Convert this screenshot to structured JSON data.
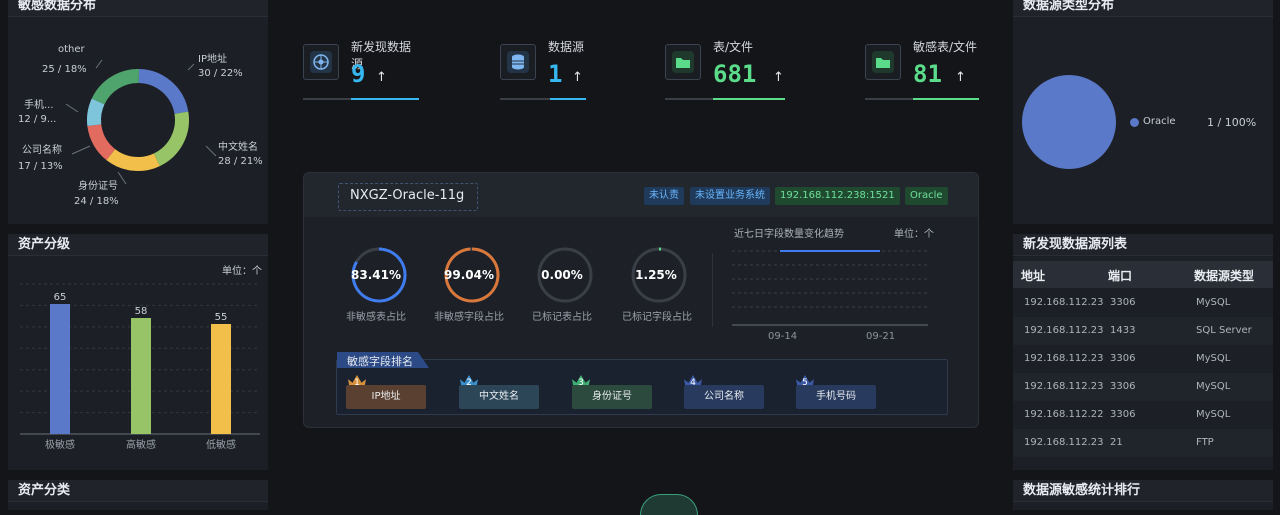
{
  "left_top": {
    "title": "敏感数据分布",
    "labels": [
      {
        "name": "other",
        "value": "25 / 18%"
      },
      {
        "name": "IP地址",
        "value": "30 / 22%"
      },
      {
        "name": "手机...",
        "value": "12 / 9..."
      },
      {
        "name": "中文姓名",
        "value": "28 / 21%"
      },
      {
        "name": "公司名称",
        "value": "17 / 13%"
      },
      {
        "name": "身份证号",
        "value": "24 / 18%"
      }
    ]
  },
  "asset_grade": {
    "title": "资产分级",
    "unit": "单位：个",
    "bar_labels": [
      "65",
      "58",
      "55"
    ],
    "categories": [
      "极敏感",
      "高敏感",
      "低敏感"
    ]
  },
  "asset_class": {
    "title": "资产分类"
  },
  "kpis": [
    {
      "label": "新发现数据源",
      "value": "9",
      "arrow": "↑",
      "color": "#36b7f0"
    },
    {
      "label": "数据源",
      "value": "1",
      "arrow": "↑",
      "color": "#36b7f0"
    },
    {
      "label": "表/文件",
      "value": "681",
      "arrow": "↑",
      "color": "#5bdc8a"
    },
    {
      "label": "敏感表/文件",
      "value": "81",
      "arrow": "↑",
      "color": "#5bdc8a"
    }
  ],
  "center": {
    "db_name": "NXGZ-Oracle-11g",
    "tags": [
      "未认责",
      "未设置业务系统",
      "192.168.112.238:1521",
      "Oracle"
    ],
    "gauges": [
      {
        "value": "83.41%",
        "label": "非敏感表占比",
        "percent": 83.41,
        "color": "#3f7cf0"
      },
      {
        "value": "99.04%",
        "label": "非敏感字段占比",
        "percent": 99.04,
        "color": "#d9783a"
      },
      {
        "value": "0.00%",
        "label": "已标记表占比",
        "percent": 0,
        "color": "#5bdc8a"
      },
      {
        "value": "1.25%",
        "label": "已标记字段占比",
        "percent": 1.25,
        "color": "#5bdc8a"
      }
    ],
    "trend_title": "近七日字段数量变化趋势",
    "trend_unit": "单位：个",
    "trend_x": [
      "09-14",
      "09-21"
    ],
    "rank_title": "敏感字段排名",
    "rank": [
      {
        "num": "1",
        "name": "IP地址"
      },
      {
        "num": "2",
        "name": "中文姓名"
      },
      {
        "num": "3",
        "name": "身份证号"
      },
      {
        "num": "4",
        "name": "公司名称"
      },
      {
        "num": "5",
        "name": "手机号码"
      }
    ]
  },
  "right_top": {
    "title": "数据源类型分布",
    "legend_name": "Oracle",
    "legend_value": "1 / 100%"
  },
  "new_sources": {
    "title": "新发现数据源列表",
    "headers": [
      "地址",
      "端口",
      "数据源类型"
    ],
    "rows": [
      [
        "192.168.112.23",
        "3306",
        "MySQL"
      ],
      [
        "192.168.112.23",
        "1433",
        "SQL Server"
      ],
      [
        "192.168.112.23",
        "3306",
        "MySQL"
      ],
      [
        "192.168.112.23",
        "3306",
        "MySQL"
      ],
      [
        "192.168.112.22",
        "3306",
        "MySQL"
      ],
      [
        "192.168.112.23",
        "21",
        "FTP"
      ]
    ]
  },
  "right_bottom": {
    "title": "数据源敏感统计排行"
  },
  "chart_data": [
    {
      "type": "pie",
      "title": "敏感数据分布",
      "categories": [
        "IP地址",
        "中文姓名",
        "身份证号",
        "公司名称",
        "手机...",
        "other"
      ],
      "values": [
        30,
        28,
        24,
        17,
        12,
        25
      ],
      "colors": [
        "#5b79c9",
        "#97c467",
        "#f2c04a",
        "#e26b5f",
        "#7ec5dc",
        "#4fa36d"
      ]
    },
    {
      "type": "bar",
      "title": "资产分级",
      "categories": [
        "极敏感",
        "高敏感",
        "低敏感"
      ],
      "values": [
        65,
        58,
        55
      ],
      "colors": [
        "#5b79c9",
        "#97c467",
        "#f2c04a"
      ],
      "ylim": [
        0,
        75
      ]
    },
    {
      "type": "pie",
      "title": "数据源类型分布",
      "categories": [
        "Oracle"
      ],
      "values": [
        1
      ],
      "colors": [
        "#5b79c9"
      ]
    }
  ]
}
